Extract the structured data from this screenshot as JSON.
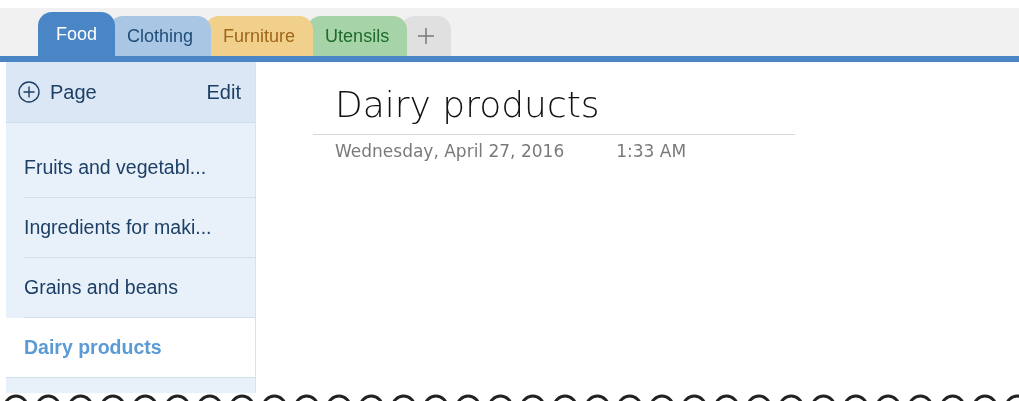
{
  "tabs": [
    {
      "label": "Food",
      "color": "#4a86c5",
      "selected": true
    },
    {
      "label": "Clothing",
      "color": "#a9c6e4",
      "selected": false
    },
    {
      "label": "Furniture",
      "color": "#f0d08a",
      "selected": false
    },
    {
      "label": "Utensils",
      "color": "#a7d3a9",
      "selected": false
    }
  ],
  "sidebar": {
    "add_label": "Page",
    "edit_label": "Edit",
    "items": [
      {
        "label": "Fruits and vegetabl...",
        "selected": false
      },
      {
        "label": "Ingredients for maki...",
        "selected": false
      },
      {
        "label": "Grains and beans",
        "selected": false
      },
      {
        "label": "Dairy products",
        "selected": true
      }
    ]
  },
  "page": {
    "title": "Dairy products",
    "date": "Wednesday,  April 27, 2016",
    "time": "1:33 AM"
  }
}
